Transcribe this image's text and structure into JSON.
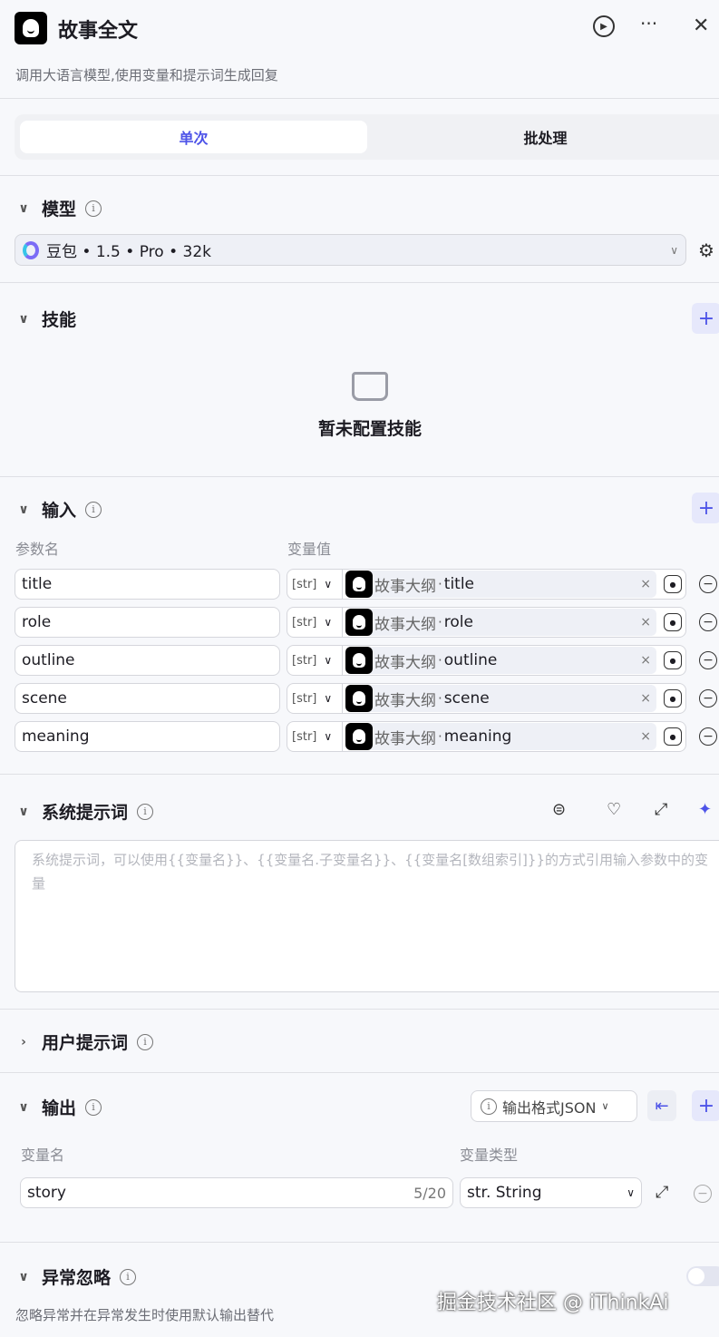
{
  "header": {
    "title": "故事全文",
    "description": "调用大语言模型,使用变量和提示词生成回复"
  },
  "tabs": [
    {
      "label": "单次",
      "active": true
    },
    {
      "label": "批处理",
      "active": false
    }
  ],
  "model": {
    "section": "模型",
    "value": "豆包 • 1.5 • Pro • 32k"
  },
  "skills": {
    "section": "技能",
    "empty": "暂未配置技能"
  },
  "input": {
    "section": "输入",
    "col_name": "参数名",
    "col_value": "变量值",
    "type_tag": "[str]",
    "source": "故事大纲",
    "sep": " · ",
    "rows": [
      {
        "name": "title",
        "ref": "title"
      },
      {
        "name": "role",
        "ref": "role"
      },
      {
        "name": "outline",
        "ref": "outline"
      },
      {
        "name": "scene",
        "ref": "scene"
      },
      {
        "name": "meaning",
        "ref": "meaning"
      }
    ]
  },
  "system_prompt": {
    "section": "系统提示词",
    "placeholder": "系统提示词，可以使用{{变量名}}、{{变量名.子变量名}}、{{变量名[数组索引]}}的方式引用输入参数中的变量"
  },
  "user_prompt": {
    "section": "用户提示词"
  },
  "output": {
    "section": "输出",
    "format": "输出格式JSON",
    "col_name": "变量名",
    "col_type": "变量类型",
    "var_name": "story",
    "count": "5/20",
    "type": "str. String"
  },
  "exception": {
    "section": "异常忽略",
    "desc": "忽略异常并在异常发生时使用默认输出替代",
    "enabled": false
  },
  "watermark": "掘金技术社区 @ iThinkAi",
  "colors": {
    "accent": "#4d53e8",
    "border": "#d5d6dc"
  }
}
